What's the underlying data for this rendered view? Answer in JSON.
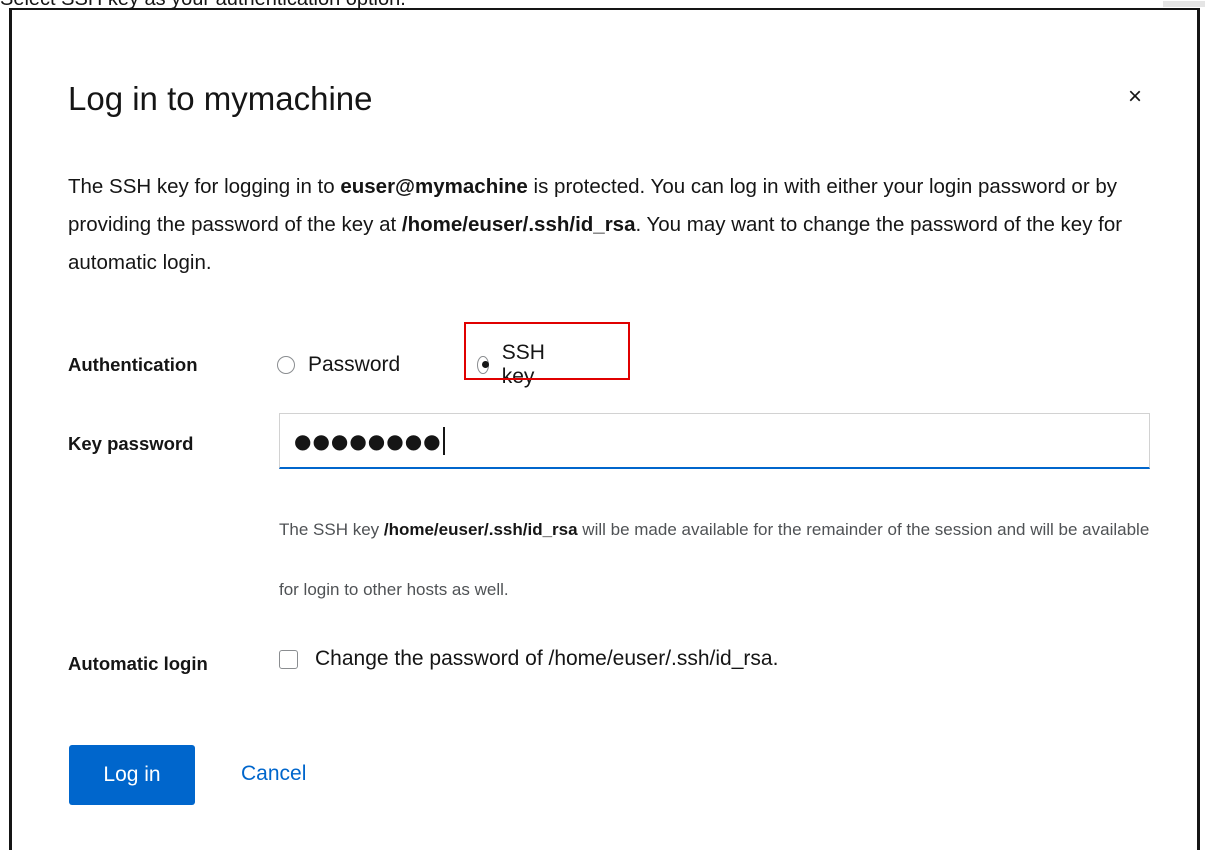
{
  "caption": {
    "text": "Select SSH key as your authentication option."
  },
  "dialog": {
    "title": "Log in to mymachine",
    "close_symbol": "×",
    "description": {
      "part1": "The SSH key for logging in to ",
      "user_host": "euser@mymachine",
      "part2": " is protected. You can log in with either your login password or by providing the password of the key at ",
      "key_path": "/home/euser/.ssh/id_rsa",
      "part3": ". You may want to change the password of the key for automatic login."
    },
    "authentication": {
      "label": "Authentication",
      "options": [
        {
          "label": "Password",
          "checked": false
        },
        {
          "label": "SSH key",
          "checked": true
        }
      ]
    },
    "key_password": {
      "label": "Key password",
      "masked_value": "●●●●●●●●",
      "helper_part1": "The SSH key ",
      "helper_path": "/home/euser/.ssh/id_rsa",
      "helper_part2": " will be made available for the remainder of the session and will be available for login to other hosts as well."
    },
    "automatic_login": {
      "label": "Automatic login",
      "checkbox_label": "Change the password of /home/euser/.ssh/id_rsa.",
      "checked": false
    },
    "buttons": {
      "login": "Log in",
      "cancel": "Cancel"
    }
  },
  "colors": {
    "primary": "#0066cc",
    "highlight": "#e00000",
    "text": "#151515",
    "helper_text": "#4f5255"
  },
  "icons": {
    "close": "close-icon",
    "radio": "radio-icon",
    "checkbox": "checkbox-icon"
  }
}
